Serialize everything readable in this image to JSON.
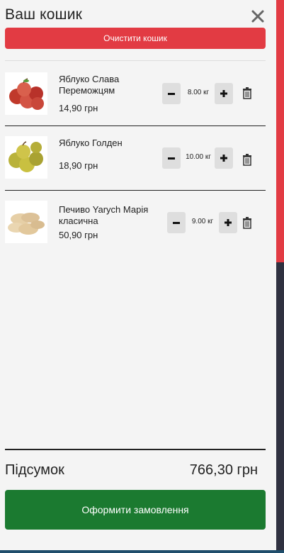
{
  "cart": {
    "title": "Ваш кошик",
    "clear_label": "Очистити кошик",
    "items": [
      {
        "name": "Яблуко Слава Переможцям",
        "price": "14,90 грн",
        "qty": "8.00 кг",
        "image": "red-apples"
      },
      {
        "name": "Яблуко Голден",
        "price": "18,90 грн",
        "qty": "10.00 кг",
        "image": "golden-apples"
      },
      {
        "name": "Печиво Yarych Марія класична",
        "price": "50,90 грн",
        "qty": "9.00 кг",
        "image": "biscuits"
      }
    ],
    "subtotal_label": "Підсумок",
    "subtotal_value": "766,30 грн",
    "checkout_label": "Оформити замовлення"
  },
  "icons": {
    "close": "close-icon",
    "minus": "minus-icon",
    "plus": "plus-icon",
    "trash": "trash-icon"
  },
  "colors": {
    "danger": "#e23b43",
    "success": "#1b7a30",
    "scrollbar_track": "#2f3140"
  }
}
